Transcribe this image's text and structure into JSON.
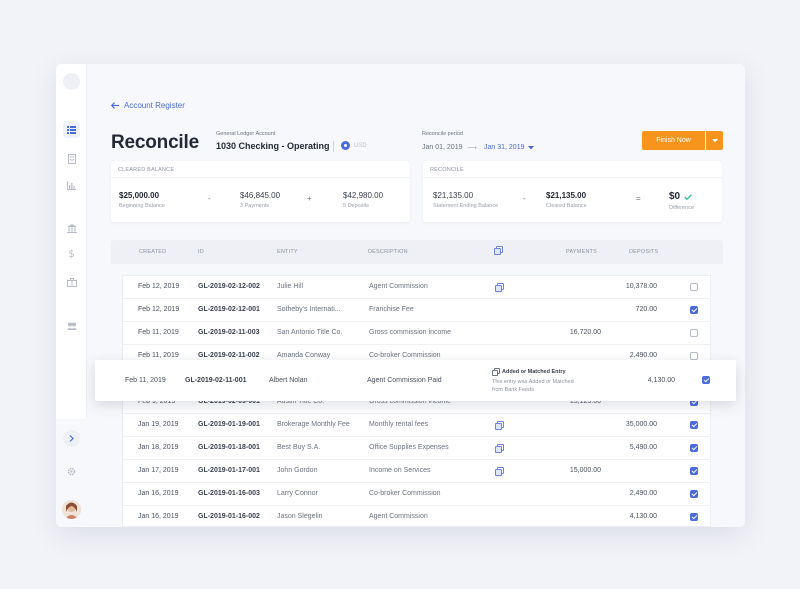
{
  "nav": {
    "back_label": "Account Register"
  },
  "page": {
    "title": "Reconcile"
  },
  "gl_account": {
    "label": "General Ledger Account",
    "value": "1030 Checking - Operating",
    "currency": "USD"
  },
  "reconcile_period": {
    "label": "Reconcile period",
    "start": "Jan 01, 2019",
    "arrow": "⟶",
    "end": "Jan 31, 2019"
  },
  "actions": {
    "finish_label": "Finish Now"
  },
  "cleared_balance": {
    "title": "Cleared Balance",
    "beginning_value": "$25,000.00",
    "beginning_label": "Beginning Balance",
    "op1": "-",
    "payments_value": "$46,845.00",
    "payments_label": "3 Payments",
    "op2": "+",
    "deposits_value": "$42,980.00",
    "deposits_label": "5 Deposits"
  },
  "reconcile_card": {
    "title": "Reconcile",
    "statement_value": "$21,135.00",
    "statement_label": "Statement Ending Balance",
    "op1": "-",
    "cleared_value": "$21,135.00",
    "cleared_label": "Cleared Balance",
    "op2": "=",
    "difference_value": "$0",
    "difference_label": "Difference"
  },
  "table": {
    "headers": {
      "created": "Created",
      "id": "ID",
      "entity": "Entity",
      "description": "Description",
      "payments": "Payments",
      "deposits": "Deposits"
    },
    "rows": [
      {
        "created": "Feb 12, 2019",
        "id": "GL-2019-02-12-002",
        "entity": "Julie Hill",
        "description": "Agent Commission",
        "payments": "",
        "deposits": "10,378.00"
      },
      {
        "created": "Feb 12, 2019",
        "id": "GL-2019-02-12-001",
        "entity": "Sotheby's Internati...",
        "description": "Franchise Fee",
        "payments": "",
        "deposits": "720.00"
      },
      {
        "created": "Feb 11, 2019",
        "id": "GL-2019-02-11-003",
        "entity": "San Antonio Title Co.",
        "description": "Gross commission income",
        "payments": "16,720.00",
        "deposits": ""
      },
      {
        "created": "Feb 11, 2019",
        "id": "GL-2019-02-11-002",
        "entity": "Amanda Conway",
        "description": "Co-broker Commission",
        "payments": "",
        "deposits": "2,490.00"
      },
      {
        "created": "Feb 11, 2019",
        "id": "GL-2019-02-11-001",
        "entity": "Albert Nolan",
        "description": "Agent Commission Paid",
        "payments": "",
        "deposits": "4,130.00"
      },
      {
        "created": "Feb 9, 2019",
        "id": "GL-2019-02-09-001",
        "entity": "Austin Title Co.",
        "description": "Gross commission income",
        "payments": "15,125.00",
        "deposits": ""
      },
      {
        "created": "Jan 19, 2019",
        "id": "GL-2019-01-19-001",
        "entity": "Brokerage Monthly Fee",
        "description": "Monthly rental fees",
        "payments": "",
        "deposits": "35,000.00"
      },
      {
        "created": "Jan 18, 2019",
        "id": "GL-2019-01-18-001",
        "entity": "Best Buy S.A.",
        "description": "Office Supplies Expenses",
        "payments": "",
        "deposits": "5,490.00"
      },
      {
        "created": "Jan 17, 2019",
        "id": "GL-2019-01-17-001",
        "entity": "John Gordon",
        "description": "Income on Services",
        "payments": "15,000.00",
        "deposits": ""
      },
      {
        "created": "Jan 16, 2019",
        "id": "GL-2019-01-16-003",
        "entity": "Larry Connor",
        "description": "Co-broker Commission",
        "payments": "",
        "deposits": "2,490.00"
      },
      {
        "created": "Jan 16, 2019",
        "id": "GL-2019-01-16-002",
        "entity": "Jason Slegelin",
        "description": "Agent Commission",
        "payments": "",
        "deposits": "4,130.00"
      }
    ],
    "matched_note": {
      "title": "Added or Matched Entry",
      "body": "This entry was Added or Matched from Bank Feeds"
    }
  },
  "colors": {
    "accent": "#4b6bdc",
    "finish": "#f7941d",
    "success": "#2ec4a0"
  },
  "icons": [
    "register-icon",
    "building-icon",
    "chart-icon",
    "bank-icon",
    "dollar-icon",
    "briefcase-icon",
    "users-icon",
    "chevron-right-icon",
    "gear-icon"
  ]
}
